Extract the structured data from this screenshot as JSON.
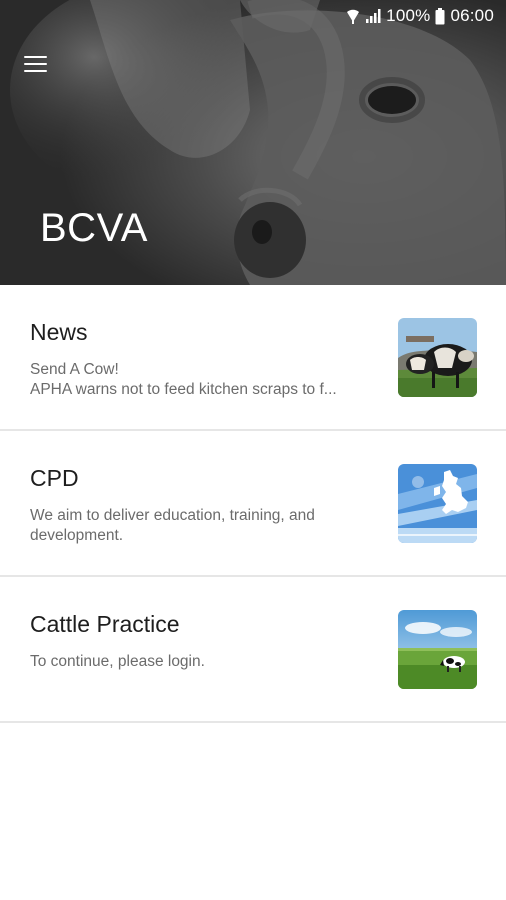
{
  "status_bar": {
    "battery": "100%",
    "time": "06:00",
    "icons": [
      "wifi-icon",
      "signal-icon",
      "battery-icon"
    ]
  },
  "header": {
    "title": "BCVA",
    "menu_icon": "hamburger-menu-icon",
    "background": "cow-photo"
  },
  "items": [
    {
      "title": "News",
      "description_lines": [
        "Send A Cow!",
        "APHA warns not to feed kitchen scraps to f..."
      ],
      "thumbnail": "cows-in-field-thumbnail"
    },
    {
      "title": "CPD",
      "description_lines": [
        "We aim to deliver education, training, and development."
      ],
      "thumbnail": "cpd-logo-thumbnail"
    },
    {
      "title": "Cattle Practice",
      "description_lines": [
        "To continue, please login."
      ],
      "thumbnail": "cow-meadow-thumbnail"
    }
  ],
  "colors": {
    "header_bg": "#2f2f2f",
    "title_text": "#ffffff",
    "body_text": "#1e1e1e",
    "secondary_text": "#6b6b6b",
    "divider": "#e6e6e6",
    "cpd_blue": "#4a90d9"
  }
}
